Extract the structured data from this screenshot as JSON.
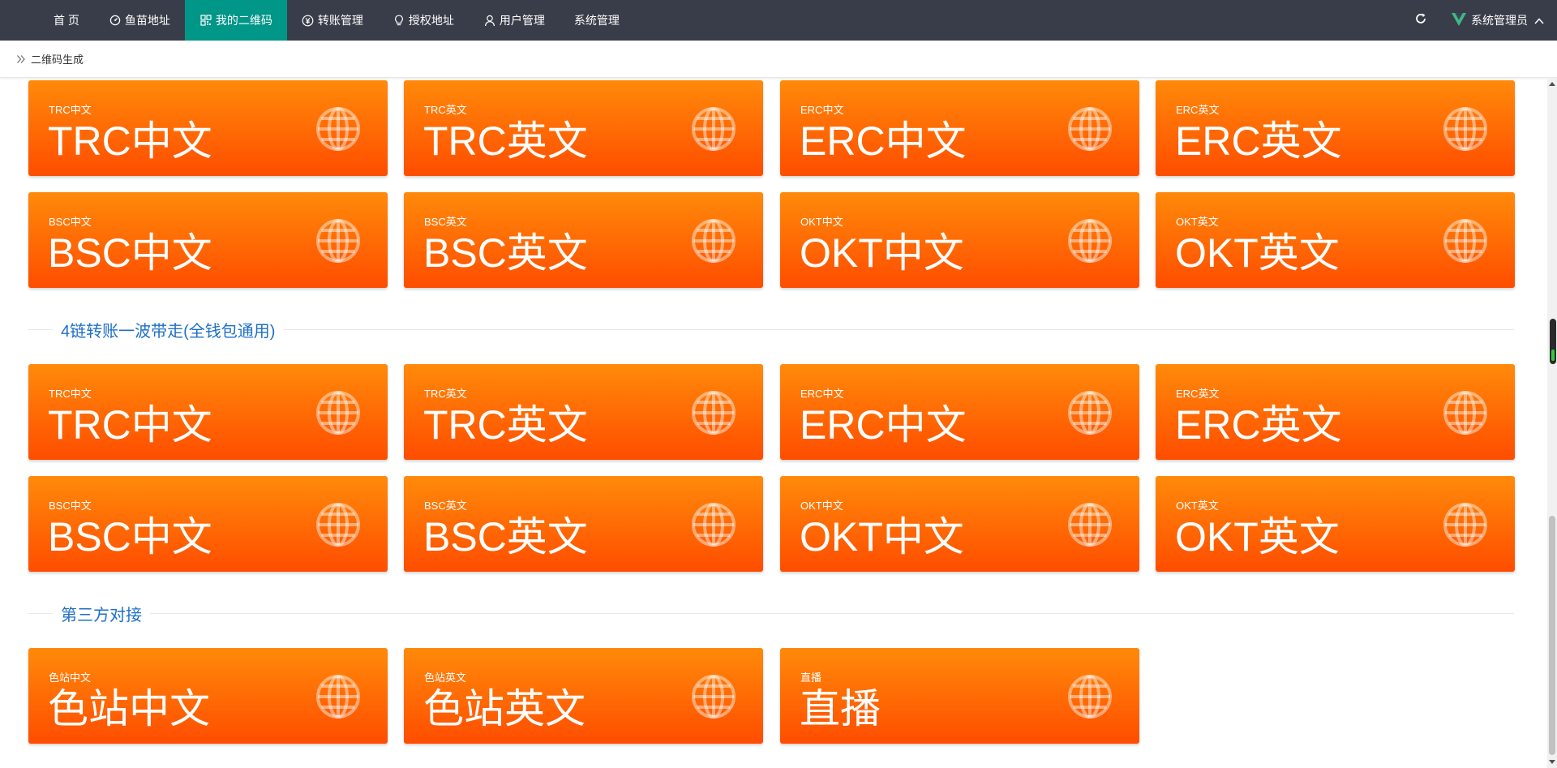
{
  "nav": {
    "items": [
      {
        "label": "首 页",
        "icon": "none"
      },
      {
        "label": "鱼苗地址",
        "icon": "dashboard-icon"
      },
      {
        "label": "我的二维码",
        "icon": "qrcode-icon",
        "active": true
      },
      {
        "label": "转账管理",
        "icon": "yen-icon"
      },
      {
        "label": "授权地址",
        "icon": "bulb-icon"
      },
      {
        "label": "用户管理",
        "icon": "user-icon"
      },
      {
        "label": "系统管理",
        "icon": "none"
      }
    ],
    "user_label": "系统管理员",
    "colors": {
      "bar": "#393d49",
      "active": "#009688",
      "logo": "#41b883"
    }
  },
  "breadcrumb": {
    "label": "二维码生成"
  },
  "colors": {
    "card_top": "#ff8a0a",
    "card_bottom": "#ff4d00",
    "section_title": "#1e6fc8"
  },
  "groups": [
    {
      "title": "",
      "cards": [
        {
          "small": "TRC中文",
          "big": "TRC中文"
        },
        {
          "small": "TRC英文",
          "big": "TRC英文"
        },
        {
          "small": "ERC中文",
          "big": "ERC中文"
        },
        {
          "small": "ERC英文",
          "big": "ERC英文"
        },
        {
          "small": "BSC中文",
          "big": "BSC中文"
        },
        {
          "small": "BSC英文",
          "big": "BSC英文"
        },
        {
          "small": "OKT中文",
          "big": "OKT中文"
        },
        {
          "small": "OKT英文",
          "big": "OKT英文"
        }
      ]
    },
    {
      "title": "4链转账一波带走(全钱包通用)",
      "cards": [
        {
          "small": "TRC中文",
          "big": "TRC中文"
        },
        {
          "small": "TRC英文",
          "big": "TRC英文"
        },
        {
          "small": "ERC中文",
          "big": "ERC中文"
        },
        {
          "small": "ERC英文",
          "big": "ERC英文"
        },
        {
          "small": "BSC中文",
          "big": "BSC中文"
        },
        {
          "small": "BSC英文",
          "big": "BSC英文"
        },
        {
          "small": "OKT中文",
          "big": "OKT中文"
        },
        {
          "small": "OKT英文",
          "big": "OKT英文"
        }
      ]
    },
    {
      "title": "第三方对接",
      "cards": [
        {
          "small": "色站中文",
          "big": "色站中文"
        },
        {
          "small": "色站英文",
          "big": "色站英文"
        },
        {
          "small": "直播",
          "big": "直播"
        }
      ]
    }
  ]
}
